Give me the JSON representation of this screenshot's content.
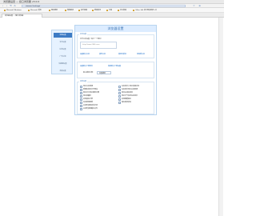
{
  "window": {
    "title": "浏览器设置 — 窗口浏览器 v3.0.0"
  },
  "navbar": {
    "url": "chrome://settings/"
  },
  "bookmarks": [
    {
      "label": "Microsoft Windows"
    },
    {
      "label": "Microsoft 首页"
    },
    {
      "label": "网页搜索"
    },
    {
      "label": "微博登录"
    },
    {
      "label": "音乐视频"
    },
    {
      "label": "新闻资讯"
    },
    {
      "label": "天猫"
    },
    {
      "label": "京东商城"
    },
    {
      "label": "Office 365 官方网站登录入口"
    }
  ],
  "tabs": [
    {
      "label": "浏览器设置 — 窗口浏览器"
    }
  ],
  "sidebar": {
    "items": [
      {
        "label": "常规设置",
        "active": true
      },
      {
        "label": "安全设置",
        "active": false
      },
      {
        "label": "标签设置",
        "active": false
      },
      {
        "label": "广告过滤",
        "active": false
      },
      {
        "label": "快捷键设置",
        "active": false
      },
      {
        "label": "高级设置",
        "active": false
      }
    ]
  },
  "panel": {
    "header": "浏览器设置",
    "startup": {
      "legend": "启动设置",
      "label": "打开主页设置（每行一个网址）",
      "placeholder": "http://www.2345.com",
      "buttons": [
        "设置默认主页",
        "清空主页",
        "使用当前页",
        "添加新主页"
      ]
    },
    "download": {
      "buttons": [
        "设置默认下载地址",
        "恢复默认下载设置"
      ],
      "label": "默认搜索引擎：",
      "selected_option": "百度搜索"
    },
    "other": {
      "legend": "其他设置",
      "checkboxes": [
        [
          "显示主页按钮",
          "在标签栏上显示快速访问"
        ],
        [
          "新建标签页打开网站",
          "在标签栏显示关闭按钮"
        ],
        [
          "地址栏中显示搜索引擎",
          "双击关闭标签页"
        ],
        [
          "显示收藏栏",
          "显示天气信息在标签栏"
        ],
        [
          "启用鼠标手势",
          "启用智能提示"
        ],
        [
          "自动检测更新",
          "保存登录状态"
        ],
        [
          "关闭时清除浏览记录",
          ""
        ],
        [
          "关闭时清除缓存文件",
          ""
        ]
      ]
    }
  }
}
